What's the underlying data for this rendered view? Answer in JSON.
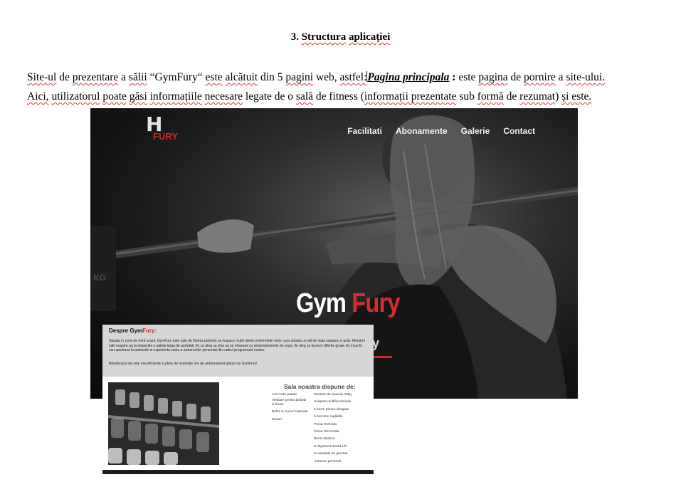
{
  "document": {
    "heading": {
      "number": "3.",
      "word1": "Structura",
      "word2": "aplicației"
    },
    "paragraph1": {
      "part1": "Site-ul",
      "part2": " de ",
      "part3": "prezentare",
      "part4": " a ",
      "part5": "sălii",
      "part6": " “GymFury“ ",
      "part7": "este",
      "part8": " ",
      "part9": "alcătuit",
      "part10": " din 5 ",
      "part11": "pagini",
      "part12": " web, ",
      "part13": "astfel:",
      "part14": "Pagina principala",
      "part15": " : ",
      "part16": " este ",
      "part17": "pagina",
      "part18": " de ",
      "part19": "pornire",
      "part20": " a ",
      "part21": "site-ului."
    },
    "paragraph2": {
      "part1": "Aici,",
      "part2": " ",
      "part3": "utilizatorul",
      "part4": " ",
      "part5": "poate",
      "part6": " ",
      "part7": "găsi",
      "part8": " ",
      "part9": "informațiile",
      "part10": " ",
      "part11": "necesare",
      "part12": " legate de o ",
      "part13": "sală",
      "part14": " de fitness (",
      "part15": "informații prezentate",
      "part16": " sub ",
      "part17": "formă",
      "part18": " de ",
      "part19": "rezumat",
      "part20": ") ",
      "part21": "și este."
    }
  },
  "hero": {
    "logo_mark": "H",
    "logo_text": "FURY",
    "nav": [
      "Facilitati",
      "Abonamente",
      "Galerie",
      "Contact"
    ],
    "brand_white": "Gym",
    "brand_red": "Fury",
    "sub_visible": "y",
    "accent_color": "#c62828"
  },
  "about": {
    "title_black": "Despre Gym",
    "title_red": "Fury:",
    "body1": "Situata in zona de nord a tarii, GymFury este sala de fitness potrivita sa inspace multe dintre preferintele celor care adopta un stil de viata sanatos si activ. Membrii salii noastre au la dispozitie o paleta larga de activitati, fie ca aleg sa vina sa se relaxeze cu antrenamentele de yoga, fie aleg sa lucreze diferite grupe de muschi sau apeleaza la statiunile si experienta vasta a antrenorilor personali din cadrul programului nostru.",
    "body2": "Beneficiaza de cele mai eficiente si pline de motivatie ore de antrenament alaturi de GymFury!",
    "sala_title": "Sala noastra dispune de:",
    "col1": [
      "144 metri patrati",
      "Vestiare pentru barbati si femei",
      "Bufet cu sucuri naturale",
      "Dusuri"
    ],
    "col2": [
      "Gantere de pana la 40kg",
      "Suripete multifunctionale",
      "5 benzi pentru alergare",
      "5 biciclete reglabile",
      "Presa Verticala",
      "Presa Orizontala",
      "Benzi elastice",
      "Echipament Dead Lift",
      "O varietate de greutati",
      "Antrenor personal"
    ]
  }
}
